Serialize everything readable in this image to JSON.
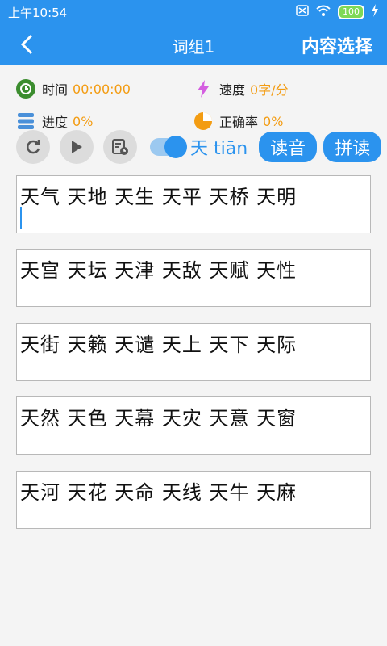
{
  "status": {
    "time": "上午10:54",
    "battery": "100"
  },
  "header": {
    "title": "词组1",
    "action": "内容选择"
  },
  "stats": {
    "time_label": "时间",
    "time_value": "00:00:00",
    "speed_label": "速度",
    "speed_value": "0字/分",
    "progress_label": "进度",
    "progress_value": "0%",
    "accuracy_label": "正确率",
    "accuracy_value": "0%"
  },
  "controls": {
    "pinyin_toggle_text": "天 tiān",
    "read_button": "读音",
    "spell_button": "拼读"
  },
  "cards": [
    "天气 天地 天生 天平 天桥 天明",
    "天宫 天坛 天津 天敌 天赋 天性",
    "天街 天籁 天谴 天上 天下 天际",
    "天然 天色 天幕 天灾 天意 天窗",
    "天河 天花 天命 天线 天牛 天麻"
  ],
  "colors": {
    "primary": "#2b93ee",
    "value": "#f39c12"
  }
}
